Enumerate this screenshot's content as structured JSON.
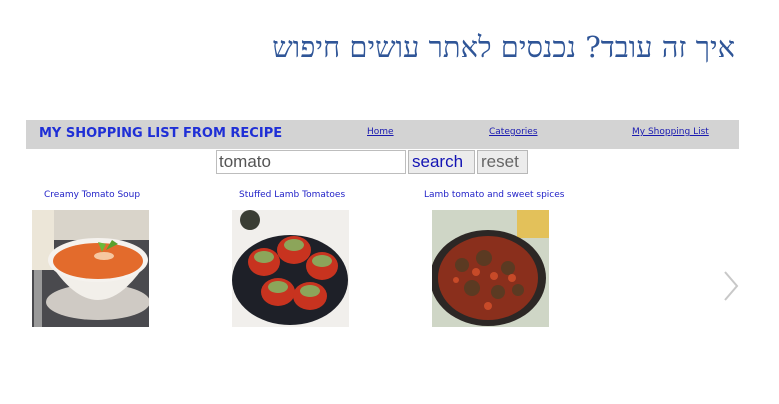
{
  "slide": {
    "title": "איך זה עובד? נכנסים לאתר עושים חיפוש"
  },
  "navbar": {
    "brand": "MY SHOPPING LIST FROM RECIPE",
    "links": [
      "Home",
      "Categories",
      "My Shopping List"
    ]
  },
  "search": {
    "value": "tomato",
    "search_label": "search",
    "reset_label": "reset"
  },
  "results": [
    {
      "title": "Creamy Tomato Soup"
    },
    {
      "title": "Stuffed Lamb Tomatoes"
    },
    {
      "title": "Lamb tomato and sweet spices"
    }
  ],
  "icons": {
    "next": "chevron-right-icon"
  },
  "colors": {
    "title": "#2f5597",
    "brand": "#1f2fd6",
    "navbar_bg": "#d3d3d3",
    "link": "#2323c8"
  }
}
